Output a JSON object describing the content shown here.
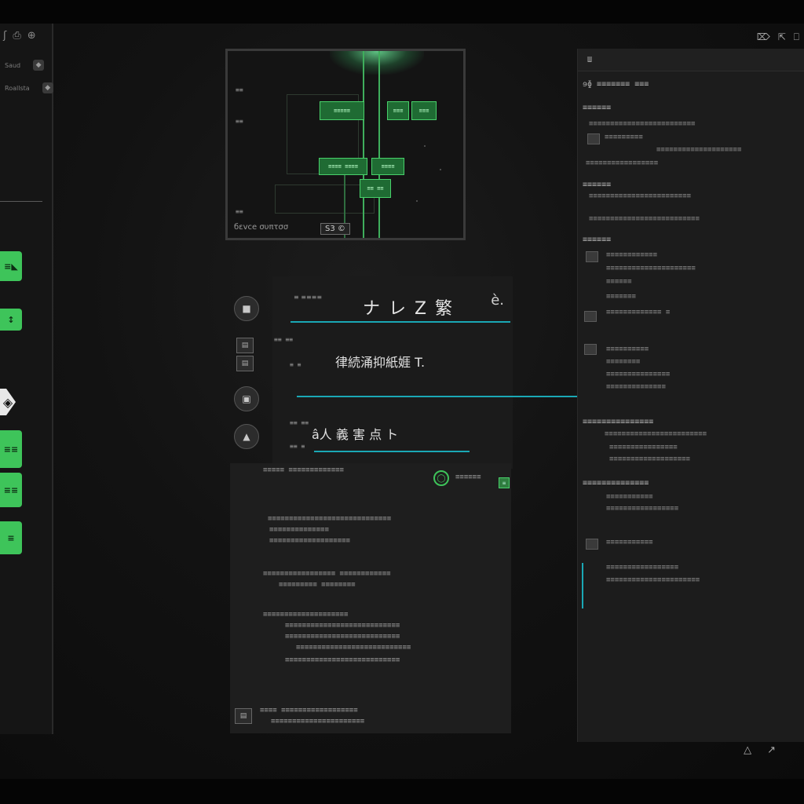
{
  "left_sidebar": {
    "top_icons": [
      "ʃ",
      "⎙",
      "⊕"
    ],
    "rows": [
      {
        "label": "Saud",
        "icon": "◆"
      },
      {
        "label": "Roallsta",
        "icon": "◆"
      }
    ],
    "chips": [
      "≡◣",
      "↕",
      "◈",
      "≡≡",
      "≡≡",
      "≡"
    ]
  },
  "preview": {
    "caption": "бεvce συπτσσ",
    "badge": "S3 ©",
    "nodes": [
      "≡≡≡≡≡",
      "≡≡≡",
      "≡≡≡",
      "≡≡≡≡ ≡≡≡≡",
      "≡≡≡≡",
      "≡≡ ≡≡"
    ],
    "side_labels": [
      "≡≡",
      "≡≡",
      "≡≡"
    ]
  },
  "mid_panel": {
    "header_mini": "≡ ≡≡≡≡",
    "title": "ナ レ Z 繁",
    "close": "è.",
    "label_1": "≡≡ ≡≡",
    "label_1b": "≡ ≡",
    "heading_1": "律続涌抑紙娾 T.",
    "label_2": "≡≡ ≡≡",
    "label_2b": "≡≡ ≡",
    "heading_2": "â人 義 害 点 ト"
  },
  "main_panel": {
    "row_label": "≡≡≡≡≡  ≡≡≡≡≡≡≡≡≡≡≡≡≡",
    "badge": "≡≡≡≡≡≡",
    "tiny_badge": "≡",
    "paragraphs": [
      [
        "≡≡≡≡≡≡≡≡≡≡≡≡≡≡≡≡≡≡≡≡≡≡≡≡≡≡≡≡≡",
        "≡≡≡≡≡≡≡≡≡≡≡≡≡≡",
        "≡≡≡≡≡≡≡≡≡≡≡≡≡≡≡≡≡≡≡"
      ],
      [
        "≡≡≡≡≡≡≡≡≡≡≡≡≡≡≡≡≡  ≡≡≡≡≡≡≡≡≡≡≡≡",
        "≡≡≡≡≡≡≡≡≡  ≡≡≡≡≡≡≡≡"
      ],
      [
        "≡≡≡≡≡≡≡≡≡≡≡≡≡≡≡≡≡≡≡≡",
        "≡≡≡≡≡≡≡≡≡≡≡≡≡≡≡≡≡≡≡≡≡≡≡≡≡≡≡",
        "≡≡≡≡≡≡≡≡≡≡≡≡≡≡≡≡≡≡≡≡≡≡≡≡≡≡≡",
        "≡≡≡≡≡≡≡≡≡≡≡≡≡≡≡≡≡≡≡≡≡≡≡≡≡≡≡",
        "≡≡≡≡≡≡≡≡≡≡≡≡≡≡≡≡≡≡≡≡≡≡≡≡≡≡≡"
      ],
      [
        "≡≡≡≡  ≡≡≡≡≡≡≡≡≡≡≡≡≡≡≡≡≡≡",
        "≡≡≡≡≡≡≡≡≡≡≡≡≡≡≡≡≡≡≡≡≡≡"
      ]
    ]
  },
  "right_panel": {
    "title": "Ш",
    "lines": [
      "ɘɸ ≡≡≡≡≡≡≡ ≡≡≡",
      "≡≡≡≡≡≡",
      "≡≡≡≡≡≡≡≡≡≡≡≡≡≡≡≡≡≡≡≡≡≡≡≡≡",
      "≡≡≡≡≡≡≡≡≡",
      "≡≡≡≡≡≡≡≡≡≡≡≡≡≡≡≡≡≡≡≡",
      "≡≡≡≡≡≡≡≡≡≡≡≡≡≡≡≡≡",
      "≡≡≡≡≡≡",
      "≡≡≡≡≡≡≡≡≡≡≡≡≡≡≡≡≡≡≡≡≡≡≡≡",
      "≡≡≡≡≡≡≡≡≡≡≡≡≡≡≡≡≡≡≡≡≡≡≡≡≡≡",
      "≡≡≡≡≡≡",
      "≡≡≡≡≡≡≡≡≡≡≡≡",
      "≡≡≡≡≡≡≡≡≡≡≡≡≡≡≡≡≡≡≡≡≡",
      "≡≡≡≡≡≡",
      "≡≡≡≡≡≡≡",
      "≡≡≡≡≡≡≡≡≡≡≡≡≡  ≡",
      "≡≡≡≡≡≡≡≡≡≡",
      "≡≡≡≡≡≡≡≡",
      "≡≡≡≡≡≡≡≡≡≡≡≡≡≡≡",
      "≡≡≡≡≡≡≡≡≡≡≡≡≡≡",
      "≡≡≡≡≡≡≡≡≡≡≡≡≡≡≡",
      "≡≡≡≡≡≡≡≡≡≡≡≡≡≡≡≡≡≡≡≡≡≡≡≡",
      "≡≡≡≡≡≡≡≡≡≡≡≡≡≡≡≡",
      "≡≡≡≡≡≡≡≡≡≡≡≡≡≡≡≡≡≡≡",
      "≡≡≡≡≡≡≡≡≡≡≡≡≡≡",
      "≡≡≡≡≡≡≡≡≡≡≡",
      "≡≡≡≡≡≡≡≡≡≡≡≡≡≡≡≡≡",
      "≡≡≡≡≡≡≡≡≡≡≡",
      "≡≡≡≡≡≡≡≡≡≡≡≡≡≡≡≡≡",
      "≡≡≡≡≡≡≡≡≡≡≡≡≡≡≡≡≡≡≡≡≡≡"
    ],
    "window_controls": [
      "⌦",
      "⇱",
      "⎕"
    ],
    "bottom_controls": [
      "△",
      "↗"
    ]
  },
  "colors": {
    "accent_cyan": "#1aa8b5",
    "accent_green": "#3ec45a",
    "panel_bg": "#1e1e1e",
    "page_bg": "#080808"
  }
}
